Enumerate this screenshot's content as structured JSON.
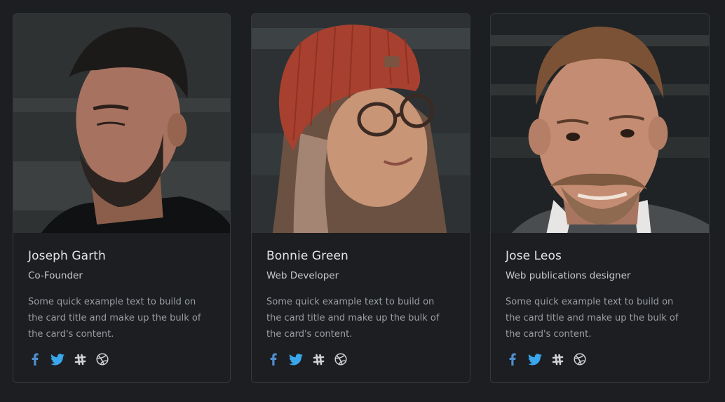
{
  "team": [
    {
      "name": "Joseph Garth",
      "role": "Co-Founder",
      "text": "Some quick example text to build on the card title and make up the bulk of the card's content.",
      "socials": [
        "facebook-icon",
        "twitter-icon",
        "slack-icon",
        "dribbble-icon"
      ]
    },
    {
      "name": "Bonnie Green",
      "role": "Web Developer",
      "text": "Some quick example text to build on the card title and make up the bulk of the card's content.",
      "socials": [
        "facebook-icon",
        "twitter-icon",
        "slack-icon",
        "dribbble-icon"
      ]
    },
    {
      "name": "Jose Leos",
      "role": "Web publications designer",
      "text": "Some quick example text to build on the card title and make up the bulk of the card's content.",
      "socials": [
        "facebook-icon",
        "twitter-icon",
        "slack-icon",
        "dribbble-icon"
      ]
    }
  ],
  "colors": {
    "background": "#1c1e21",
    "card_border": "#35383d",
    "facebook": "#4f8fcf",
    "twitter": "#3aa6ec",
    "slack": "#cfd2d6",
    "dribbble": "#cfd2d6"
  }
}
